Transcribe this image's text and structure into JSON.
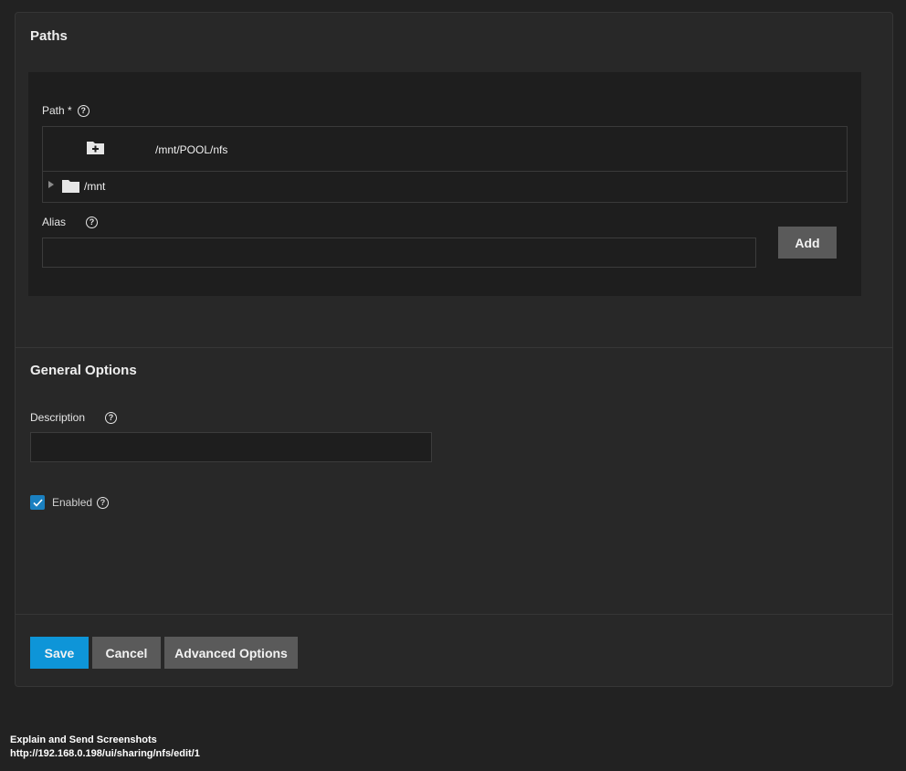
{
  "paths_section": {
    "title": "Paths",
    "path_label": "Path *",
    "path_value": "/mnt/POOL/nfs",
    "tree": [
      {
        "label": "/mnt",
        "icon": "folder-icon"
      }
    ],
    "alias_label": "Alias",
    "alias_value": "",
    "add_label": "Add"
  },
  "general_section": {
    "title": "General Options",
    "description_label": "Description",
    "description_value": "",
    "enabled_label": "Enabled",
    "enabled_checked": true
  },
  "actions": {
    "save_label": "Save",
    "cancel_label": "Cancel",
    "advanced_label": "Advanced Options"
  },
  "footer": {
    "line1": "Explain and Send Screenshots",
    "line2": "http://192.168.0.198/ui/sharing/nfs/edit/1"
  },
  "colors": {
    "background": "#222222",
    "card": "#282828",
    "primary_button": "#0e95d8",
    "secondary_button": "#5a5a5a",
    "checkbox": "#1a80c0"
  }
}
